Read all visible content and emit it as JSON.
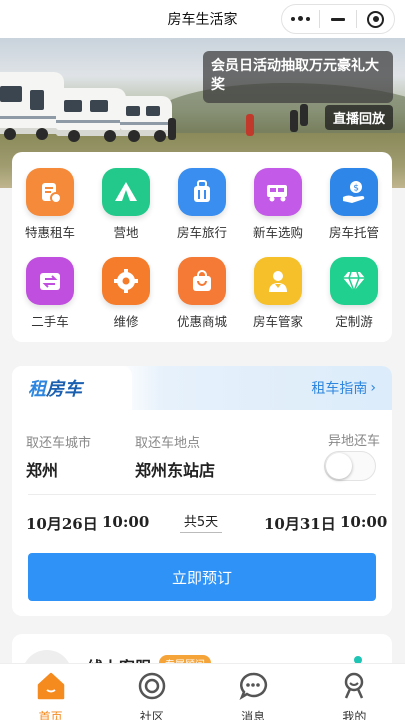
{
  "app": {
    "title": "房车生活家"
  },
  "banner": {
    "announcement": "会员日活动抽取万元豪礼大奖",
    "replay_label": "直播回放"
  },
  "categories": [
    {
      "label": "特惠租车",
      "icon": "rent-car-icon",
      "color": "#f58a3a"
    },
    {
      "label": "营地",
      "icon": "camp-tent-icon",
      "color": "#22c98a"
    },
    {
      "label": "房车旅行",
      "icon": "luggage-icon",
      "color": "#3a8ef0"
    },
    {
      "label": "新车选购",
      "icon": "rv-cart-icon",
      "color": "#c45ae8"
    },
    {
      "label": "房车托管",
      "icon": "hand-coin-icon",
      "color": "#2e86e8"
    },
    {
      "label": "二手车",
      "icon": "exchange-icon",
      "color": "#c04fe0"
    },
    {
      "label": "维修",
      "icon": "gear-icon",
      "color": "#f57c2a"
    },
    {
      "label": "优惠商城",
      "icon": "shopping-bag-icon",
      "color": "#f57a35"
    },
    {
      "label": "房车管家",
      "icon": "butler-icon",
      "color": "#f5c02a"
    },
    {
      "label": "定制游",
      "icon": "diamond-icon",
      "color": "#1fd08e"
    }
  ],
  "rent": {
    "title_part1": "租",
    "title_part2": "房车",
    "guide_label": "租车指南",
    "city_label": "取还车城市",
    "city_value": "郑州",
    "location_label": "取还车地点",
    "location_value": "郑州东站店",
    "remote_return_label": "异地还车",
    "remote_return_on": false,
    "pickup_date": "10月26日",
    "pickup_time": "10:00",
    "duration": "共5天",
    "return_date": "10月31日",
    "return_time": "10:00",
    "book_label": "立即预订"
  },
  "service": {
    "title": "线上客服",
    "badge": "专属顾问"
  },
  "tabbar": [
    {
      "label": "首页",
      "icon": "home-icon",
      "active": true
    },
    {
      "label": "社区",
      "icon": "community-icon",
      "active": false
    },
    {
      "label": "消息",
      "icon": "message-icon",
      "active": false
    },
    {
      "label": "我的",
      "icon": "profile-icon",
      "active": false
    }
  ],
  "colors": {
    "accent": "#2e92f6",
    "tab_active": "#f58a1f",
    "link": "#2e86de"
  }
}
